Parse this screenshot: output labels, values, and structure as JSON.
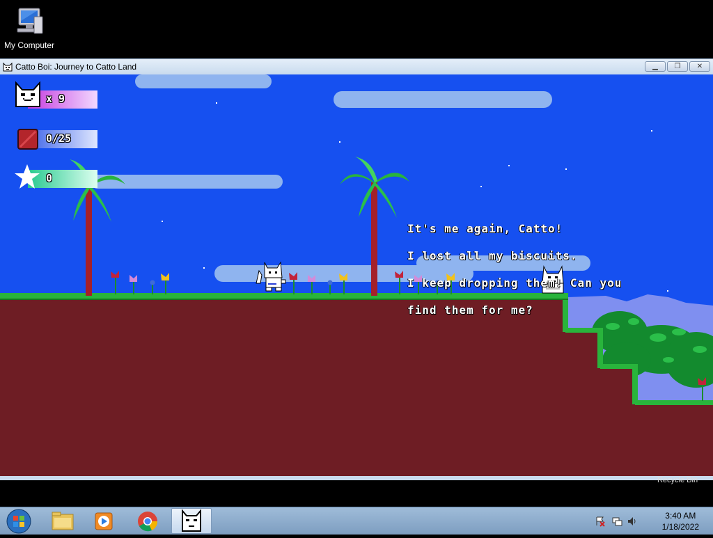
{
  "desktop": {
    "icon_label": "My Computer",
    "recycle_label": "Recycle Bin"
  },
  "window": {
    "title": "Catto Boi: Journey to Catto Land",
    "buttons": [
      "minimize",
      "restore",
      "close"
    ]
  },
  "hud": {
    "lives": "x 9",
    "biscuits": "0/25",
    "stars": "0"
  },
  "dialog": {
    "lines": [
      "It's me again, Catto!",
      "I lost all my biscuits.",
      "I keep dropping them! Can you",
      "find them for me?"
    ]
  },
  "taskbar": {
    "items": [
      "start-orb",
      "file-explorer",
      "media-player",
      "chrome",
      "catto-boi"
    ],
    "time": "3:40 AM",
    "date": "1/18/2022"
  },
  "colors": {
    "sky": "#1650f0",
    "dirt": "#6e1d24",
    "grass": "#29b43c",
    "cloud": "#8fb4ef"
  }
}
